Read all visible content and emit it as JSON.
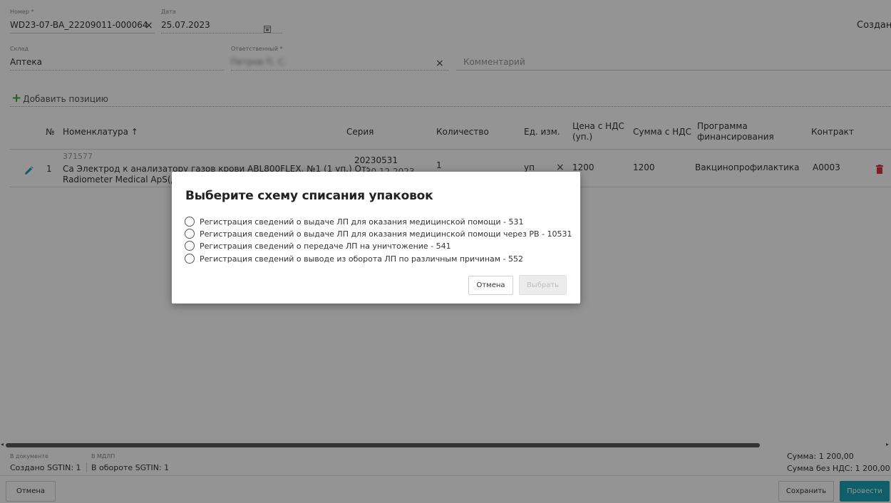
{
  "header": {
    "number_label": "Номер *",
    "number_value": "WD23-07-BA_22209011-000064",
    "date_label": "Дата",
    "date_value": "25.07.2023",
    "status_text": "Создан"
  },
  "fields": {
    "warehouse_label": "Склад",
    "warehouse_value": "Аптека",
    "responsible_label": "Ответственный *",
    "responsible_value": "Петров П. С.",
    "comment_placeholder": "Комментарий"
  },
  "add_position_label": "Добавить позицию",
  "table": {
    "columns": [
      "№",
      "Номенклатура ↑",
      "Серия",
      "Количество",
      "Ед. изм.",
      "Цена с НДС (ул.)",
      "Сумма с НДС",
      "Программа финансирования",
      "Контракт"
    ],
    "column_price_line1": "Цена с НДС",
    "column_price_line2": "(уп.)",
    "column_program_line1": "Программа",
    "column_program_line2": "финансирования",
    "row": {
      "index": "1",
      "code": "371577",
      "name_line1": "Са Электрод к анализатору газов крови ABL800FLEX, №1 (1 уп.) От:",
      "name_line2": "Radiometer Medical ApS(Д",
      "series": "20230531",
      "series_sub": "— 30.12.2023",
      "quantity": "1",
      "unit": "уп",
      "price": "1200",
      "sum": "1200",
      "program": "Вакцинопрофилактика",
      "contract": "А0003"
    }
  },
  "modal": {
    "title": "Выберите схему списания упаковок",
    "options": [
      "Регистрация сведений о выдаче ЛП для оказания медицинской помощи - 531",
      "Регистрация сведений о выдаче ЛП для оказания медицинской помощи через РВ - 10531",
      "Регистрация сведений о передаче ЛП на уничтожение - 541",
      "Регистрация сведений о выводе из оборота ЛП по различным причинам - 552"
    ],
    "cancel_label": "Отмена",
    "select_label": "Выбрать"
  },
  "footer": {
    "in_document_label": "В документе",
    "in_document_value": "Создано SGTIN: 1",
    "mdlp_label": "В МДЛП",
    "mdlp_value": "В обороте SGTIN: 1",
    "sum_text": "Сумма: 1 200,00",
    "sum_no_vat_text": "Сумма без НДС: 1 200,00",
    "cancel_label": "Отмена",
    "save_label": "Сохранить",
    "submit_label": "Провести"
  },
  "colors": {
    "accent": "#1ba3b7",
    "add_icon": "#3aa843",
    "edit_icon": "#17a2b8",
    "delete_icon": "#dc3545"
  }
}
